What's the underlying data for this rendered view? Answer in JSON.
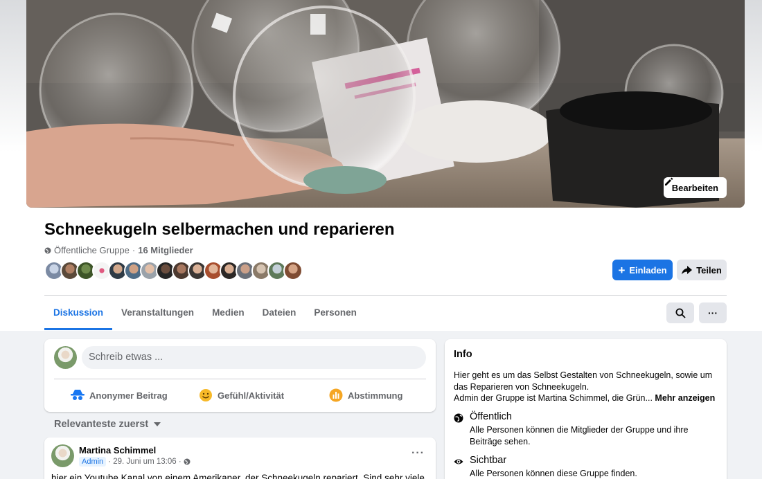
{
  "colors": {
    "accent": "#1b74e4",
    "secondary_text": "#65676b",
    "button_gray": "#e4e6eb"
  },
  "cover": {
    "edit_label": "Bearbeiten"
  },
  "group": {
    "title": "Schneekugeln selbermachen und reparieren",
    "privacy": "Öffentliche Gruppe",
    "separator": "·",
    "members": "16 Mitglieder",
    "invite_label": "Einladen",
    "share_label": "Teilen"
  },
  "tabs": [
    {
      "label": "Diskussion",
      "active": true
    },
    {
      "label": "Veranstaltungen",
      "active": false
    },
    {
      "label": "Medien",
      "active": false
    },
    {
      "label": "Dateien",
      "active": false
    },
    {
      "label": "Personen",
      "active": false
    }
  ],
  "tools": {
    "search_icon": "search-icon",
    "more_icon": "more-icon",
    "more_text": "···"
  },
  "composer": {
    "placeholder": "Schreib etwas ...",
    "actions": [
      {
        "label": "Anonymer Beitrag",
        "icon": "anonymous-icon",
        "color": "#1877f2"
      },
      {
        "label": "Gefühl/Aktivität",
        "icon": "smiley-icon",
        "color": "#f7b928"
      },
      {
        "label": "Abstimmung",
        "icon": "poll-icon",
        "color": "#f5a623"
      }
    ]
  },
  "sort": {
    "label": "Relevanteste zuerst"
  },
  "post": {
    "author": "Martina Schimmel",
    "badge": "Admin",
    "time": "· 29. Juni um 13:06 ·",
    "more": "···",
    "text": "hier ein Youtube Kanal von einem Amerikaner, der Schneekugeln repariert. Sind sehr viele"
  },
  "info": {
    "title": "Info",
    "description": "Hier geht es um das Selbst Gestalten von Schneekugeln, sowie um das Reparieren von Schneekugeln.",
    "description2": "Admin der Gruppe ist Martina Schimmel, die Grün...",
    "more_label": "Mehr anzeigen",
    "public_title": "Öffentlich",
    "public_text": "Alle Personen können die Mitglieder der Gruppe und ihre Beiträge sehen.",
    "visible_title": "Sichtbar",
    "visible_text": "Alle Personen können diese Gruppe finden."
  }
}
